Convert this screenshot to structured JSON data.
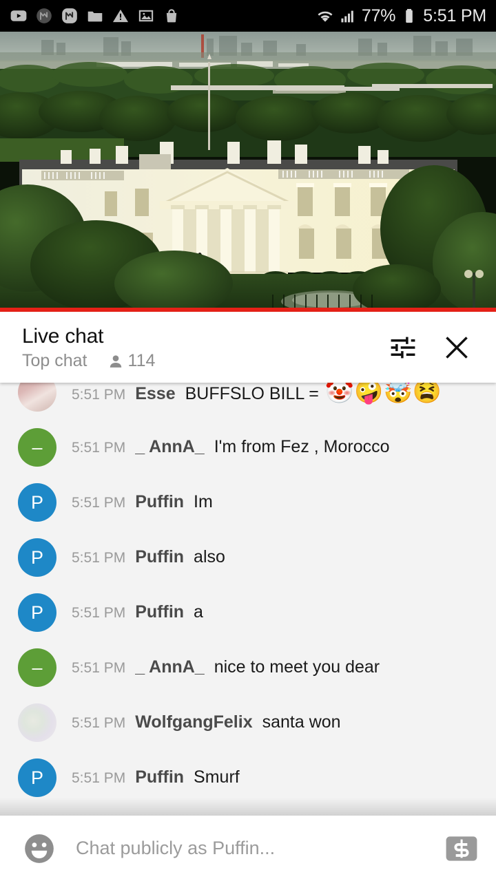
{
  "status_bar": {
    "icons": [
      {
        "name": "youtube-icon",
        "label": "YouTube"
      },
      {
        "name": "messenger-dark-icon",
        "label": "M"
      },
      {
        "name": "messenger-icon",
        "label": "M"
      },
      {
        "name": "folder-icon",
        "label": "Folder"
      },
      {
        "name": "warning-icon",
        "label": "Warning"
      },
      {
        "name": "photo-icon",
        "label": "Photos"
      },
      {
        "name": "shopping-bag-icon",
        "label": "Shop"
      }
    ],
    "wifi": "wifi-icon",
    "signal": "cellular-signal-icon",
    "battery_percent": "77%",
    "battery": "battery-icon",
    "time": "5:51 PM"
  },
  "video": {
    "name": "white-house-live-stream",
    "progress_percent": 100,
    "progress_color": "#e62117"
  },
  "chat_header": {
    "title": "Live chat",
    "subtitle": "Top chat",
    "viewer_count": "114",
    "viewer_icon": "person-icon",
    "settings_icon": "tune-sliders-icon",
    "close_icon": "close-icon"
  },
  "messages": [
    {
      "time": "5:51 PM",
      "author": "Esse",
      "text": "BUFFSLO BILL = ",
      "emojis": [
        "🤡",
        "🤪",
        "🤯",
        "😫"
      ],
      "avatar_type": "photo1",
      "avatar_initial": ""
    },
    {
      "time": "5:51 PM",
      "author": "_ AnnA_",
      "text": "I'm from Fez , Morocco",
      "emojis": [],
      "avatar_type": "green",
      "avatar_initial": "–"
    },
    {
      "time": "5:51 PM",
      "author": "Puffin",
      "text": "Im",
      "emojis": [],
      "avatar_type": "blue",
      "avatar_initial": "P"
    },
    {
      "time": "5:51 PM",
      "author": "Puffin",
      "text": "also",
      "emojis": [],
      "avatar_type": "blue",
      "avatar_initial": "P"
    },
    {
      "time": "5:51 PM",
      "author": "Puffin",
      "text": "a",
      "emojis": [],
      "avatar_type": "blue",
      "avatar_initial": "P"
    },
    {
      "time": "5:51 PM",
      "author": "_ AnnA_",
      "text": "nice to meet you dear",
      "emojis": [],
      "avatar_type": "green",
      "avatar_initial": "–"
    },
    {
      "time": "5:51 PM",
      "author": "WolfgangFelix",
      "text": "santa won",
      "emojis": [],
      "avatar_type": "photo2",
      "avatar_initial": ""
    },
    {
      "time": "5:51 PM",
      "author": "Puffin",
      "text": "Smurf",
      "emojis": [],
      "avatar_type": "blue",
      "avatar_initial": "P"
    }
  ],
  "input_bar": {
    "emoji_icon": "emoji-smiley-icon",
    "placeholder": "Chat publicly as Puffin...",
    "value": "",
    "superchat_icon": "super-chat-dollar-icon"
  },
  "colors": {
    "accent": "#e62117",
    "chat_bg": "#f3f3f3",
    "avatar_blue": "#1e88c7",
    "avatar_green": "#5d9e37",
    "status_bar_bg": "#000000"
  }
}
